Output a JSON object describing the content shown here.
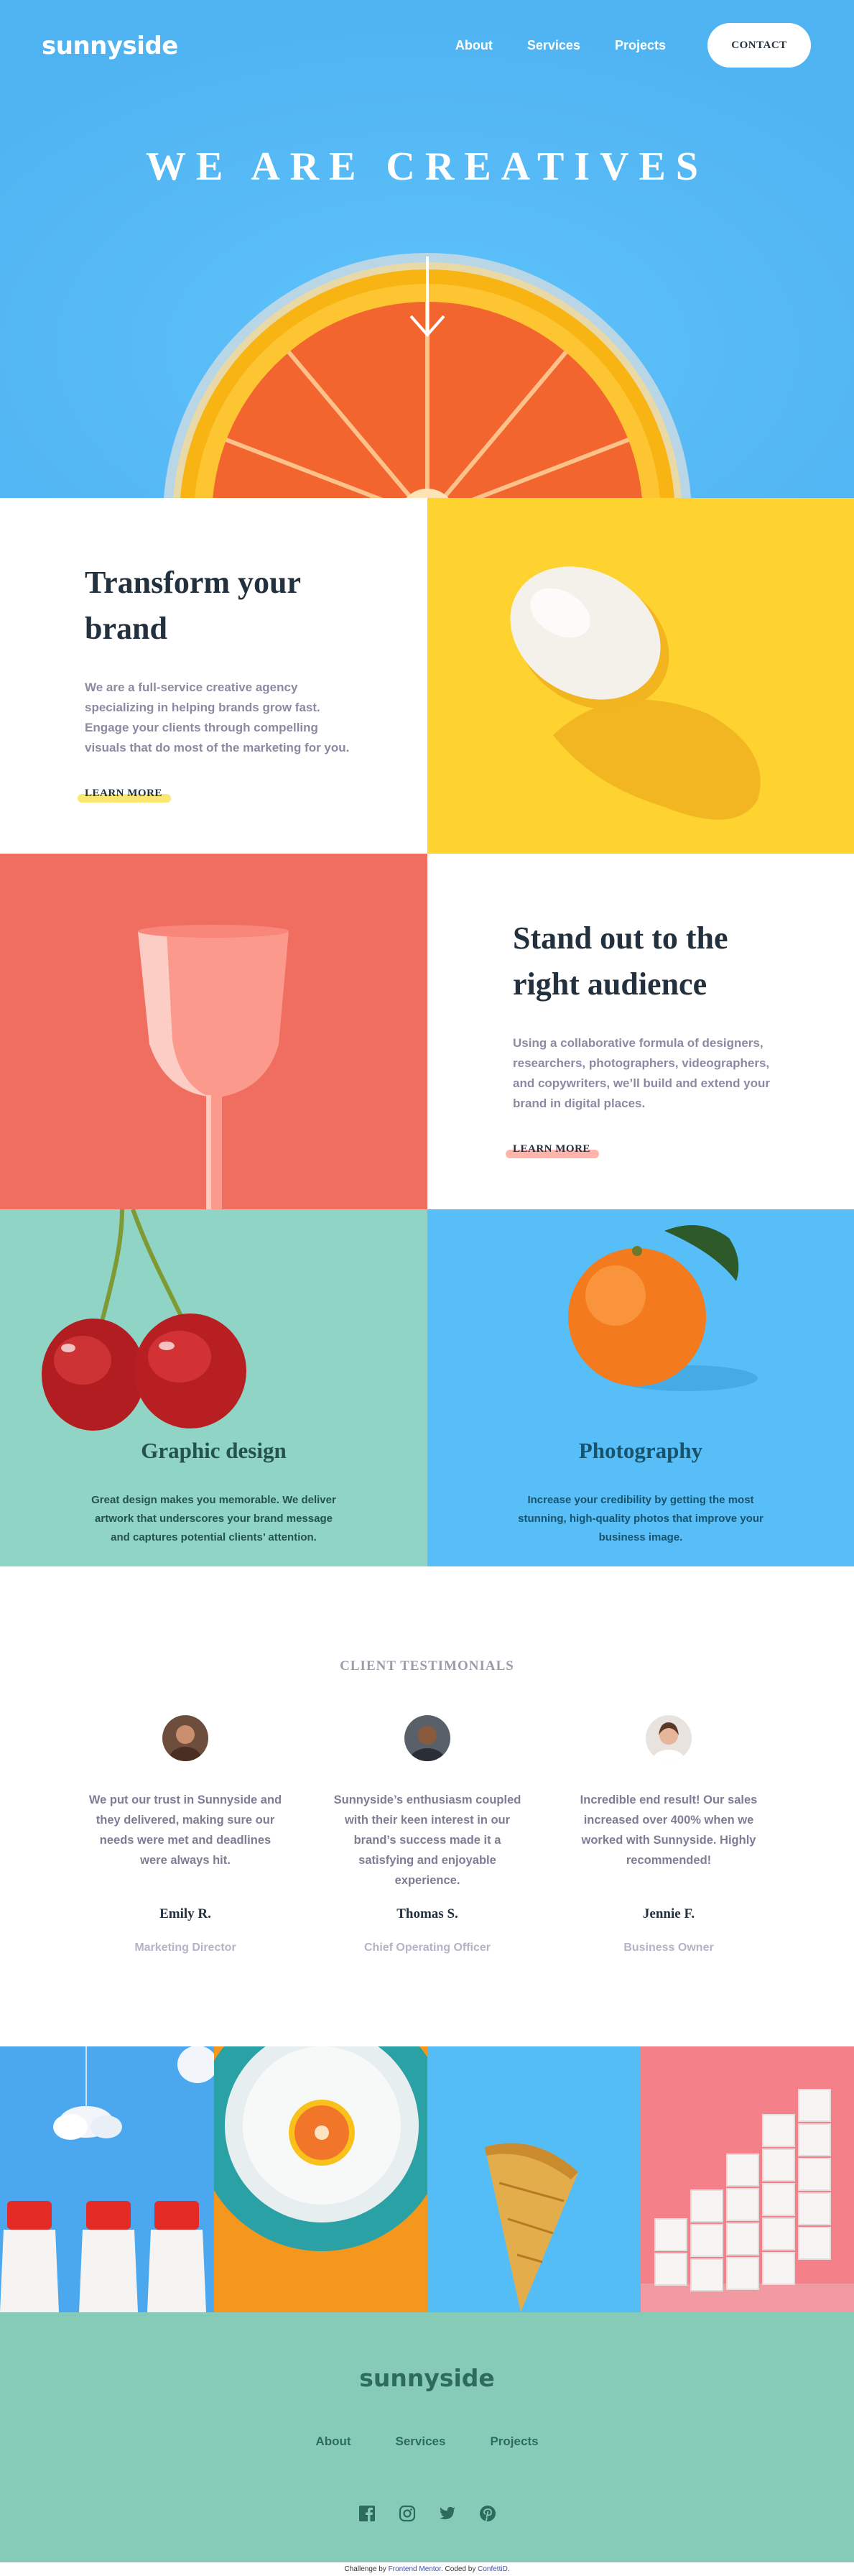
{
  "header": {
    "logo": "sunnyside",
    "nav": [
      "About",
      "Services",
      "Projects"
    ],
    "contact": "CONTACT",
    "hero_title": "WE ARE CREATIVES"
  },
  "features": [
    {
      "title_line1": "Transform your",
      "title_line2": "brand",
      "body": "We are a full-service creative agency specializing in helping brands grow fast. Engage your clients through compelling visuals that do most of the marketing for you.",
      "cta": "LEARN MORE",
      "highlight_color": "#fad400"
    },
    {
      "title_line1": "Stand out to the",
      "title_line2": "right audience",
      "body": "Using a collaborative formula of designers, researchers, photographers, videographers, and copywriters, we’ll build and extend your brand in digital places.",
      "cta": "LEARN MORE",
      "highlight_color": "#fe7766"
    }
  ],
  "services": [
    {
      "title": "Graphic design",
      "body": "Great design makes you memorable. We deliver artwork that underscores your brand message and captures potential clients’ attention.",
      "text_color": "#24534b",
      "bg": "#90d4c5"
    },
    {
      "title": "Photography",
      "body": "Increase your credibility by getting the most stunning, high-quality photos that improve your business image.",
      "text_color": "#19536b",
      "bg": "#57bef8"
    }
  ],
  "testimonials": {
    "title": "CLIENT TESTIMONIALS",
    "items": [
      {
        "quote": "We put our trust in Sunnyside and they delivered, making sure our needs were met and deadlines were always hit.",
        "name": "Emily R.",
        "role": "Marketing Director"
      },
      {
        "quote": "Sunnyside’s enthusiasm coupled with their keen interest in our brand’s success made it a satisfying and enjoyable experience.",
        "name": "Thomas S.",
        "role": "Chief Operating Officer"
      },
      {
        "quote": "Incredible end result! Our sales increased over 400% when we worked with Sunnyside. Highly recommended!",
        "name": "Jennie F.",
        "role": "Business Owner"
      }
    ]
  },
  "footer": {
    "logo": "sunnyside",
    "nav": [
      "About",
      "Services",
      "Projects"
    ],
    "social_icons": [
      "facebook-icon",
      "instagram-icon",
      "twitter-icon",
      "pinterest-icon"
    ]
  },
  "attribution": {
    "prefix": "Challenge by ",
    "fm": "Frontend Mentor",
    "mid": ". Coded by ",
    "author": "ConfettiD",
    "suffix": "."
  },
  "colors": {
    "hero_bg": "#55baf6",
    "footer_bg": "#85cbb7",
    "dark_text": "#23303e"
  }
}
